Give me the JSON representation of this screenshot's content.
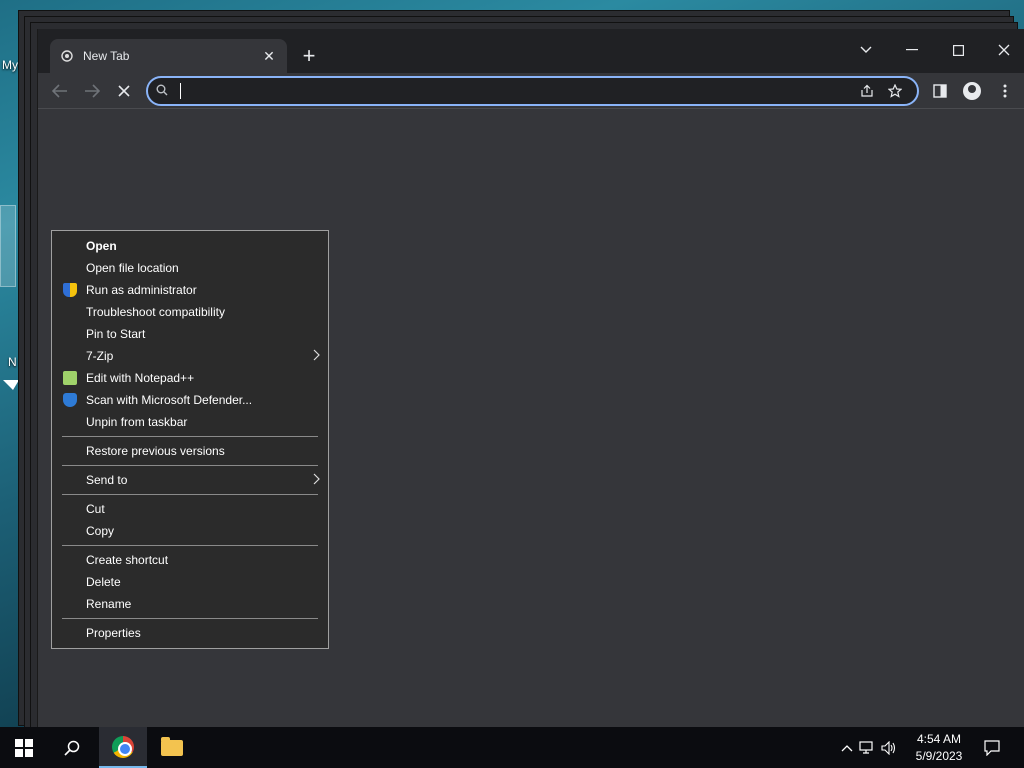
{
  "desktop": {
    "labels": [
      "My",
      "N"
    ]
  },
  "browser": {
    "tab_title": "New Tab",
    "tab_icon": "chrome-favicon-icon",
    "omnibox": {
      "value": "",
      "placeholder": ""
    }
  },
  "context_menu": {
    "items": [
      {
        "label": "Open",
        "bold": true
      },
      {
        "label": "Open file location"
      },
      {
        "label": "Run as administrator",
        "icon": "uac-shield-icon"
      },
      {
        "label": "Troubleshoot compatibility"
      },
      {
        "label": "Pin to Start"
      },
      {
        "label": "7-Zip",
        "submenu": true
      },
      {
        "label": "Edit with Notepad++",
        "icon": "notepad-plus-plus-icon"
      },
      {
        "label": "Scan with Microsoft Defender...",
        "icon": "defender-shield-icon"
      },
      {
        "label": "Unpin from taskbar"
      },
      {
        "label": "Restore previous versions"
      },
      {
        "label": "Send to",
        "submenu": true
      },
      {
        "label": "Cut"
      },
      {
        "label": "Copy"
      },
      {
        "label": "Create shortcut"
      },
      {
        "label": "Delete"
      },
      {
        "label": "Rename"
      },
      {
        "label": "Properties"
      }
    ]
  },
  "taskbar": {
    "time": "4:54 AM",
    "date": "5/9/2023"
  },
  "colors": {
    "accent": "#8ab4f8",
    "titlebar": "#202124",
    "window": "#35363a",
    "menu_bg": "#2b2b2b",
    "taskbar": "#0b0c10"
  }
}
